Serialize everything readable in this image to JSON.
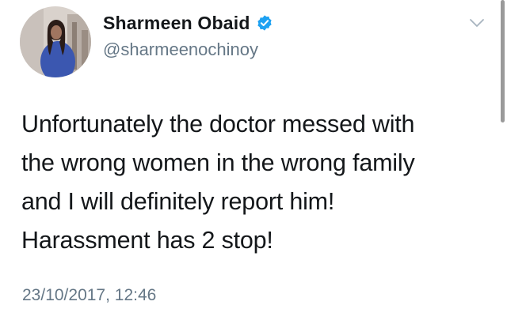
{
  "tweet": {
    "author": {
      "display_name": "Sharmeen Obaid",
      "handle": "@sharmeenochinoy",
      "verified": true
    },
    "text_lines": [
      "Unfortunately the doctor messed with",
      "the wrong women in the wrong family",
      "and I will definitely report him!",
      "Harassment has 2 stop!"
    ],
    "timestamp": "23/10/2017, 12:46"
  },
  "icons": {
    "avatar": "profile-photo",
    "verified": "verified-badge-icon",
    "menu": "chevron-down-icon"
  },
  "colors": {
    "text": "#14171a",
    "secondary_text": "#657786",
    "verified_blue": "#1da1f2",
    "background": "#ffffff"
  }
}
